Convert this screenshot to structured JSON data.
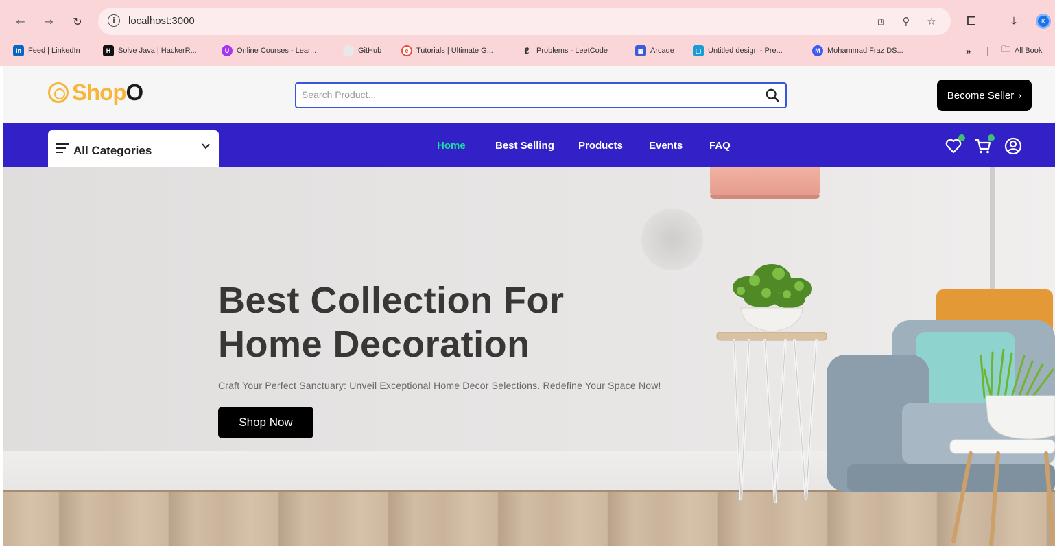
{
  "browser": {
    "url": "localhost:3000",
    "profile_initial": "K",
    "bookmarks": [
      {
        "label": "Feed | LinkedIn",
        "icon": "linkedin-icon",
        "color": "#0a66c2",
        "glyph": "in"
      },
      {
        "label": "Solve Java | HackerR...",
        "icon": "hackerrank-icon",
        "color": "#111111",
        "glyph": "H"
      },
      {
        "label": "Online Courses - Lear...",
        "icon": "udemy-icon",
        "color": "#a435f0",
        "glyph": "U"
      },
      {
        "label": "GitHub",
        "icon": "github-icon",
        "color": "#e8e8e8",
        "glyph": ""
      },
      {
        "label": "Tutorials | Ultimate G...",
        "icon": "tutorials-icon",
        "color": "#e74c3c",
        "glyph": "e"
      },
      {
        "label": "Problems - LeetCode",
        "icon": "leetcode-icon",
        "color": "#ffa116",
        "glyph": "L"
      },
      {
        "label": "Arcade",
        "icon": "arcade-icon",
        "color": "#3b5bd9",
        "glyph": "A"
      },
      {
        "label": "Untitled design - Pre...",
        "icon": "canva-icon",
        "color": "#00c4cc",
        "glyph": "C"
      },
      {
        "label": "Mohammad Fraz DS...",
        "icon": "fraz-icon",
        "color": "#3d5af1",
        "glyph": "M"
      }
    ],
    "more_label": "»",
    "all_bookmarks_label": "All Book"
  },
  "header": {
    "logo_main": "Shop",
    "logo_end": "O",
    "search_placeholder": "Search Product...",
    "seller_button": "Become Seller",
    "seller_arrow": "›"
  },
  "nav": {
    "categories_label": "All Categories",
    "links": [
      {
        "label": "Home",
        "active": true
      },
      {
        "label": "Best Selling",
        "active": false
      },
      {
        "label": "Products",
        "active": false
      },
      {
        "label": "Events",
        "active": false
      },
      {
        "label": "FAQ",
        "active": false
      }
    ],
    "icons": [
      "heart-icon",
      "cart-icon",
      "user-icon"
    ]
  },
  "hero": {
    "title_line1": "Best Collection For",
    "title_line2": "Home Decoration",
    "subtitle": "Craft Your Perfect Sanctuary: Unveil Exceptional Home Decor Selections. Redefine Your Space Now!",
    "button": "Shop Now"
  },
  "colors": {
    "brand_yellow": "#f5b63b",
    "nav_blue": "#3321c8",
    "active_green": "#17dd9d",
    "search_border": "#3957db",
    "browser_chrome": "#fbd6d8"
  }
}
